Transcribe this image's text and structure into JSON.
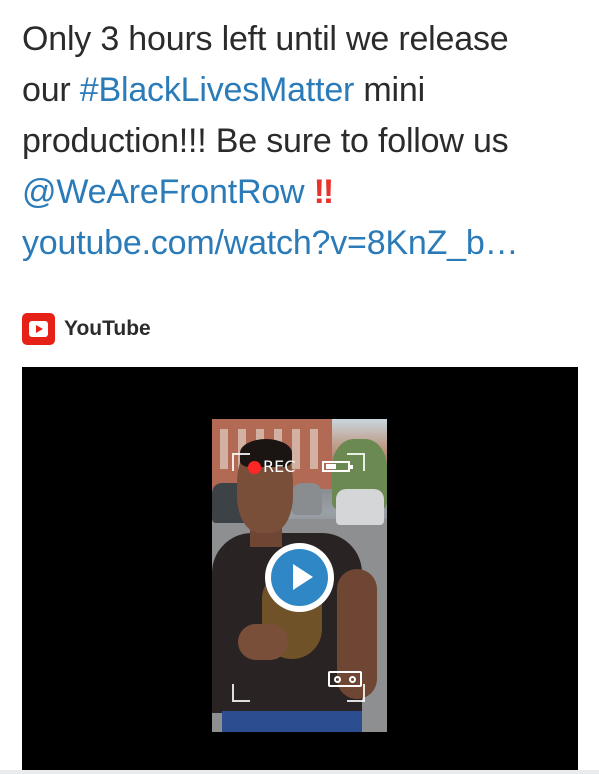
{
  "tweet": {
    "line1": "Only 3 hours left until we release",
    "line2_prefix": "our ",
    "hashtag": "#BlackLivesMatter",
    "line2_suffix": " mini",
    "line3": "production!!! Be sure to follow us",
    "mention": "@WeAreFrontRow",
    "alarm": "‼",
    "url": "youtube.com/watch?v=8KnZ_b…"
  },
  "card": {
    "source_icon": "youtube-logo-icon",
    "source_label": "YouTube",
    "video": {
      "overlay_text": "REC",
      "play_icon": "play-icon"
    }
  },
  "colors": {
    "link": "#2b7bb9",
    "text": "#2b2b2b",
    "alarm": "#e8322c",
    "youtube_red": "#e62117",
    "play_blue": "#2f87c6"
  }
}
